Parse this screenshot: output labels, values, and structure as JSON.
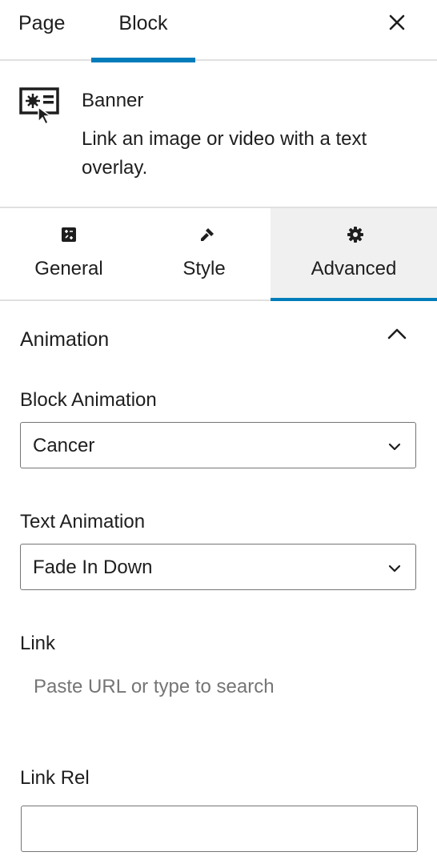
{
  "header": {
    "tabs": [
      {
        "label": "Page"
      },
      {
        "label": "Block",
        "active": true
      }
    ]
  },
  "block": {
    "name": "Banner",
    "description": "Link an image or video with a text overlay."
  },
  "sub_tabs": [
    {
      "label": "General",
      "icon": "general-icon"
    },
    {
      "label": "Style",
      "icon": "brush-icon"
    },
    {
      "label": "Advanced",
      "icon": "gear-icon",
      "active": true
    }
  ],
  "panel": {
    "title": "Animation",
    "block_animation": {
      "label": "Block Animation",
      "value": "Cancer"
    },
    "text_animation": {
      "label": "Text Animation",
      "value": "Fade In Down"
    },
    "link": {
      "label": "Link",
      "placeholder": "Paste URL or type to search"
    },
    "link_rel": {
      "label": "Link Rel",
      "value": ""
    }
  },
  "colors": {
    "accent": "#007cba",
    "border": "#757575",
    "divider": "#e0e0e0",
    "active_tab_bg": "#f0f0f0"
  }
}
